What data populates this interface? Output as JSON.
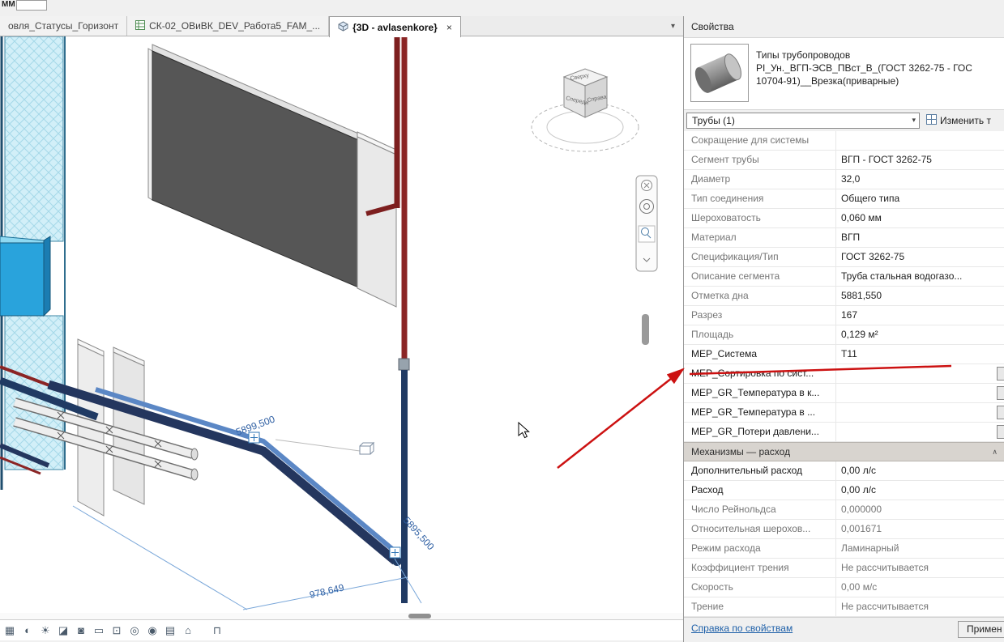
{
  "window": {
    "fragment_top_left": "ММ"
  },
  "tabbar": {
    "tabs": [
      {
        "label": "овля_Статусы_Горизонт"
      },
      {
        "label": "СК-02_ОВиВК_DEV_Работа5_FAM_..."
      },
      {
        "label": "{3D - avlasenkore}"
      }
    ],
    "dropdown_arrow": "▾",
    "close_glyph": "×"
  },
  "viewport": {
    "viewcube": {
      "top": "Сверху",
      "front": "Спереди",
      "right": "Справа"
    },
    "dimensions": {
      "dim1": "5899,500",
      "dim2": "5895,500",
      "dim3": "978,649"
    }
  },
  "view_control_bar": {
    "icons": [
      {
        "name": "detail-level",
        "glyph": "▦"
      },
      {
        "name": "visual-style",
        "glyph": "◐"
      },
      {
        "name": "sun-path",
        "glyph": "☀"
      },
      {
        "name": "shadows",
        "glyph": "◪"
      },
      {
        "name": "rendering",
        "glyph": "◙"
      },
      {
        "name": "crop-view",
        "glyph": "▭"
      },
      {
        "name": "show-crop",
        "glyph": "⊡"
      },
      {
        "name": "hide-isolate",
        "glyph": "◎"
      },
      {
        "name": "reveal-hidden",
        "glyph": "◉"
      },
      {
        "name": "view-properties",
        "glyph": "▤"
      },
      {
        "name": "displace-elements",
        "glyph": "⌂"
      },
      {
        "name": "constraints",
        "glyph": "⊓"
      }
    ]
  },
  "properties_panel": {
    "title": "Свойства",
    "type_selector": {
      "line1": "Типы трубопроводов",
      "line2": "PI_Ун._ВГП-ЭСВ_ПВст_В_(ГОСТ 3262-75 - ГОС",
      "line3": "10704-91)__Врезка(приварные)"
    },
    "filter_combo": {
      "value": "Трубы (1)"
    },
    "edit_type_button": {
      "label": "Изменить т"
    },
    "groups": [
      {
        "rows": [
          {
            "label": "Сокращение для системы",
            "value": ""
          },
          {
            "label": "Сегмент трубы",
            "value": "ВГП - ГОСТ 3262-75"
          },
          {
            "label": "Диаметр",
            "value": "32,0"
          },
          {
            "label": "Тип соединения",
            "value": "Общего типа"
          },
          {
            "label": "Шероховатость",
            "value": "0,060 мм"
          },
          {
            "label": "Материал",
            "value": "ВГП"
          },
          {
            "label": "Спецификация/Тип",
            "value": "ГОСТ 3262-75"
          },
          {
            "label": "Описание сегмента",
            "value": "Труба стальная водогазо..."
          },
          {
            "label": "Отметка дна",
            "value": "5881,550"
          },
          {
            "label": "Разрез",
            "value": "167"
          },
          {
            "label": "Площадь",
            "value": "0,129 м²"
          },
          {
            "label": "MEP_Система",
            "value": "Т11"
          },
          {
            "label": "MEP_Сортировка по сист...",
            "value": ""
          },
          {
            "label": "MEP_GR_Температура в к...",
            "value": ""
          },
          {
            "label": "MEP_GR_Температура в ...",
            "value": ""
          },
          {
            "label": "MEP_GR_Потери давлени...",
            "value": ""
          }
        ]
      },
      {
        "header": "Механизмы — расход",
        "collapse_glyph": "∧",
        "rows": [
          {
            "label": "Дополнительный расход",
            "value": "0,00 л/с"
          },
          {
            "label": "Расход",
            "value": "0,00 л/с"
          },
          {
            "label": "Число Рейнольдса",
            "value": "0,000000"
          },
          {
            "label": "Относительная шерохов...",
            "value": "0,001671"
          },
          {
            "label": "Режим расхода",
            "value": "Ламинарный"
          },
          {
            "label": "Коэффициент трения",
            "value": "Не рассчитывается"
          },
          {
            "label": "Скорость",
            "value": "0,00 м/с"
          },
          {
            "label": "Трение",
            "value": "Не рассчитывается"
          }
        ]
      }
    ],
    "footer": {
      "help_link": "Справка по свойствам",
      "apply_button": "Примен"
    }
  },
  "colors": {
    "annotation_red": "#cc1111",
    "accent_blue": "#2e75b6",
    "pipe_navy": "#24365e",
    "pipe_red": "#8b2525"
  }
}
